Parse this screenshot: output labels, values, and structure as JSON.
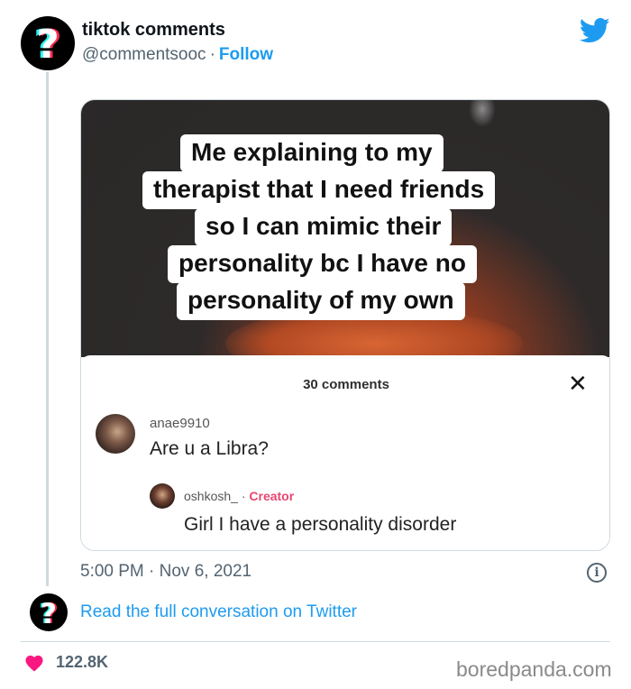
{
  "author": {
    "display_name": "tiktok comments",
    "handle": "@commentsooc",
    "separator": "·",
    "follow_label": "Follow"
  },
  "media": {
    "caption_lines": [
      "Me explaining to my",
      "therapist that I need friends",
      "so I can mimic their",
      "personality bc I have no",
      "personality of my own"
    ],
    "comments_header": "30 comments",
    "close_glyph": "✕",
    "comment": {
      "username": "anae9910",
      "text": "Are u a Libra?"
    },
    "reply": {
      "username": "oshkosh_",
      "separator": "·",
      "badge": "Creator",
      "text": "Girl I have a personality disorder"
    }
  },
  "timestamp": "5:00 PM · Nov 6, 2021",
  "info_glyph": "i",
  "read_more_label": "Read the full conversation on Twitter",
  "likes_count": "122.8K",
  "watermark": "boredpanda.com",
  "colors": {
    "link": "#1d9bf0",
    "heart": "#f91880",
    "creator_badge": "#e6466e"
  }
}
